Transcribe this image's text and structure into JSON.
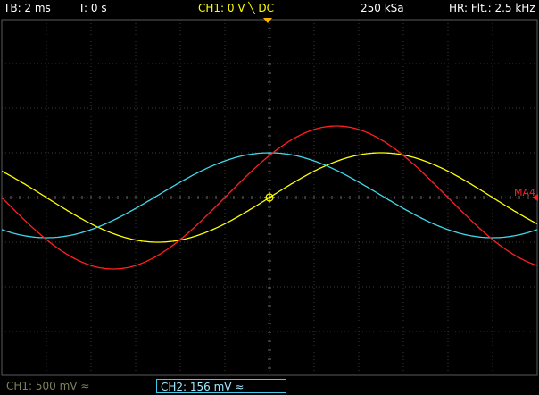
{
  "header": {
    "timebase": "TB: 2 ms",
    "trigger_time": "T: 0 s",
    "ch1_setting": "CH1: 0 V ╲ DC",
    "sample_rate": "250 kSa",
    "hr_filter": "HR: Flt.: 2.5 kHz"
  },
  "marker": {
    "label": "MA4"
  },
  "channels": {
    "ch1": "CH1: 500 mV ≈",
    "ch2": "CH2: 156 mV ≈"
  },
  "colors": {
    "background": "#000000",
    "grid": "#3a3a3a",
    "ch1": "#ffff00",
    "ch2": "#3fd9e9",
    "math": "#ff2020",
    "trigger_marker": "#ffb000"
  },
  "chart_data": {
    "type": "line",
    "grid": true,
    "x_divisions": 12,
    "y_divisions": 8,
    "series": [
      {
        "name": "CH1",
        "color": "#ffff00",
        "amplitude_div": 1.0,
        "center_div": 0.0,
        "peak_x_div": 2.5,
        "period_div": 10.0
      },
      {
        "name": "CH2",
        "color": "#3fd9e9",
        "amplitude_div": 0.95,
        "center_div": 0.05,
        "peak_x_div": 0.0,
        "period_div": 10.0
      },
      {
        "name": "MA4",
        "color": "#ff2020",
        "amplitude_div": 1.6,
        "center_div": 0.0,
        "peak_x_div": 1.5,
        "period_div": 10.0
      }
    ]
  }
}
